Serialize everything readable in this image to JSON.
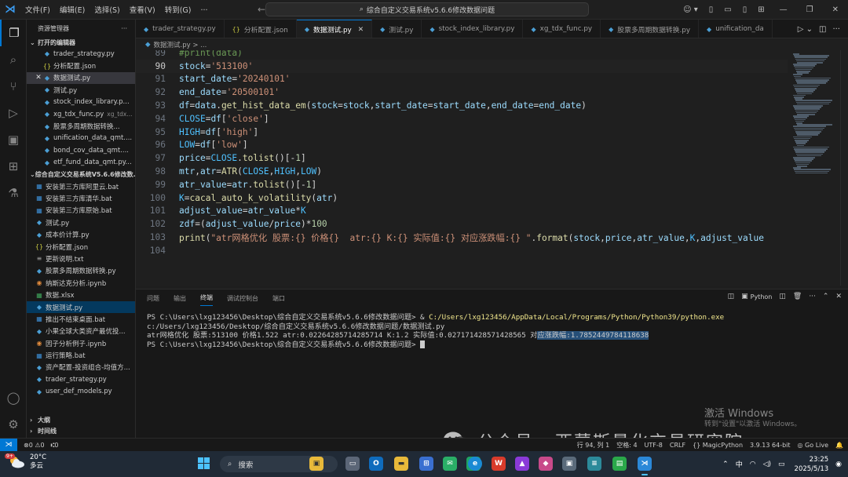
{
  "titlebar": {
    "menu": [
      "文件(F)",
      "编辑(E)",
      "选择(S)",
      "查看(V)",
      "转到(G)",
      "···"
    ],
    "search": "综合自定义交易系统v5.6.6修改数据问题"
  },
  "sidebar": {
    "header": "资源管理器",
    "open_editors_label": "打开的编辑器",
    "open_editors": [
      {
        "name": "trader_strategy.py",
        "type": "py"
      },
      {
        "name": "分析配置.json",
        "type": "json"
      },
      {
        "name": "数据测试.py",
        "type": "py",
        "close": "✕"
      },
      {
        "name": "测试.py",
        "type": "py"
      },
      {
        "name": "stock_index_library.p...",
        "type": "py"
      },
      {
        "name": "xg_tdx_func.py",
        "type": "py",
        "hint": "xg_tdx..."
      },
      {
        "name": "股票多周期数据转换...",
        "type": "py"
      },
      {
        "name": "unification_data_qmt....",
        "type": "py"
      },
      {
        "name": "bond_cov_data_qmt....",
        "type": "py"
      },
      {
        "name": "etf_fund_data_qmt.py...",
        "type": "py"
      }
    ],
    "folder_label": "综合自定义交易系统V5.6.6修改数...",
    "files": [
      {
        "name": "安装第三方库阿里云.bat",
        "type": "bat"
      },
      {
        "name": "安装第三方库清华.bat",
        "type": "bat"
      },
      {
        "name": "安装第三方库原始.bat",
        "type": "bat"
      },
      {
        "name": "测试.py",
        "type": "py"
      },
      {
        "name": "成本价计算.py",
        "type": "py"
      },
      {
        "name": "分析配置.json",
        "type": "json"
      },
      {
        "name": "更新说明.txt",
        "type": "txt"
      },
      {
        "name": "股票多周期数据转换.py",
        "type": "py"
      },
      {
        "name": "纳斯达克分析.ipynb",
        "type": "nb"
      },
      {
        "name": "数据.xlsx",
        "type": "xl"
      },
      {
        "name": "数据测试.py",
        "type": "py"
      },
      {
        "name": "推出不结束桌面.bat",
        "type": "bat"
      },
      {
        "name": "小果全球大类资产最优投...",
        "type": "py"
      },
      {
        "name": "因子分析例子.ipynb",
        "type": "nb"
      },
      {
        "name": "运行策略.bat",
        "type": "bat"
      },
      {
        "name": "资产配置-投资组合-均值方...",
        "type": "py"
      },
      {
        "name": "trader_strategy.py",
        "type": "py"
      },
      {
        "name": "user_def_models.py",
        "type": "py"
      }
    ],
    "outline_label": "大纲",
    "timeline_label": "时间线"
  },
  "tabs": [
    {
      "label": "trader_strategy.py",
      "type": "py"
    },
    {
      "label": "分析配置.json",
      "type": "json"
    },
    {
      "label": "数据测试.py",
      "type": "py",
      "active": true
    },
    {
      "label": "测试.py",
      "type": "py"
    },
    {
      "label": "stock_index_library.py",
      "type": "py"
    },
    {
      "label": "xg_tdx_func.py",
      "type": "py"
    },
    {
      "label": "股票多周期数据转换.py",
      "type": "py"
    },
    {
      "label": "unification_da",
      "type": "py"
    }
  ],
  "breadcrumb": "数据测试.py > ...",
  "editor": {
    "current_line": "90",
    "lines": [
      {
        "n": "89",
        "html": "<span class='c'>#print(data)</span>"
      },
      {
        "n": "90",
        "html": "<span class='v'>stock</span><span class='o'>=</span><span class='s'>'513100'</span>"
      },
      {
        "n": "91",
        "html": "<span class='v'>start_date</span><span class='o'>=</span><span class='s'>'20240101'</span>"
      },
      {
        "n": "92",
        "html": "<span class='v'>end_date</span><span class='o'>=</span><span class='s'>'20500101'</span>"
      },
      {
        "n": "93",
        "html": "<span class='v'>df</span><span class='o'>=</span><span class='v'>data</span><span class='o'>.</span><span class='f'>get_hist_data_em</span><span class='o'>(</span><span class='v'>stock</span><span class='o'>=</span><span class='v'>stock</span><span class='o'>,</span><span class='v'>start_date</span><span class='o'>=</span><span class='v'>start_date</span><span class='o'>,</span><span class='v'>end_date</span><span class='o'>=</span><span class='v'>end_date</span><span class='o'>)</span>"
      },
      {
        "n": "94",
        "html": "<span class='k'>CLOSE</span><span class='o'>=</span><span class='v'>df</span><span class='o'>[</span><span class='s'>'close'</span><span class='o'>]</span>"
      },
      {
        "n": "95",
        "html": "<span class='k'>HIGH</span><span class='o'>=</span><span class='v'>df</span><span class='o'>[</span><span class='s'>'high'</span><span class='o'>]</span>"
      },
      {
        "n": "96",
        "html": "<span class='k'>LOW</span><span class='o'>=</span><span class='v'>df</span><span class='o'>[</span><span class='s'>'low'</span><span class='o'>]</span>"
      },
      {
        "n": "97",
        "html": "<span class='v'>price</span><span class='o'>=</span><span class='k'>CLOSE</span><span class='o'>.</span><span class='f'>tolist</span><span class='o'>()[-</span><span class='n'>1</span><span class='o'>]</span>"
      },
      {
        "n": "98",
        "html": "<span class='v'>mtr</span><span class='o'>,</span><span class='v'>atr</span><span class='o'>=</span><span class='f'>ATR</span><span class='o'>(</span><span class='k'>CLOSE</span><span class='o'>,</span><span class='k'>HIGH</span><span class='o'>,</span><span class='k'>LOW</span><span class='o'>)</span>"
      },
      {
        "n": "99",
        "html": "<span class='v'>atr_value</span><span class='o'>=</span><span class='v'>atr</span><span class='o'>.</span><span class='f'>tolist</span><span class='o'>()[-</span><span class='n'>1</span><span class='o'>]</span>"
      },
      {
        "n": "100",
        "html": "<span class='k'>K</span><span class='o'>=</span><span class='f'>cacal_auto_k_volatility</span><span class='o'>(</span><span class='v'>atr</span><span class='o'>)</span>"
      },
      {
        "n": "101",
        "html": "<span class='v'>adjust_value</span><span class='o'>=</span><span class='v'>atr_value</span><span class='o'>*</span><span class='k'>K</span>"
      },
      {
        "n": "102",
        "html": "<span class='v'>zdf</span><span class='o'>=(</span><span class='v'>adjust_value</span><span class='o'>/</span><span class='v'>price</span><span class='o'>)*</span><span class='n'>100</span>"
      },
      {
        "n": "103",
        "html": "<span class='f'>print</span><span class='o'>(</span><span class='s'>\"atr网格优化 股票:{} 价格{}  atr:{} K:{} 实际值:{} 对应涨跌幅:{} \"</span><span class='o'>.</span><span class='f'>format</span><span class='o'>(</span><span class='v'>stock</span><span class='o'>,</span><span class='v'>price</span><span class='o'>,</span><span class='v'>atr_value</span><span class='o'>,</span><span class='k'>K</span><span class='o'>,</span><span class='v'>adjust_value</span>"
      },
      {
        "n": "104",
        "html": ""
      }
    ]
  },
  "panel": {
    "tabs": [
      "问题",
      "输出",
      "终端",
      "调试控制台",
      "端口"
    ],
    "active_tab": "终端",
    "shell": "Python",
    "terminal": {
      "cmd_prompt": "PS C:\\Users\\lxg123456\\Desktop\\综合自定义交易系统v5.6.6修改数据问题> & ",
      "cmd_exe": "C:/Users/lxg123456/AppData/Local/Programs/Python/Python39/python.exe",
      "cmd_arg": " c:/Users/lxg123456/Desktop/综合自定义交易系统v5.6.6修改数据问题/数据测试.py",
      "output_main": "atr网格优化 股票:513100 价格1.522  atr:0.02264285714285714 K:1.2 实际值:0.027171428571428565 对",
      "output_hl": "应涨跌幅:1.7852449784118638",
      "last_prompt": "PS C:\\Users\\lxg123456\\Desktop\\综合自定义交易系统v5.6.6修改数据问题> "
    }
  },
  "watermark": {
    "activate_title": "激活 Windows",
    "activate_sub": "转到\"设置\"以激活 Windows。",
    "wechat": "公众号 · 西蒙斯量化交易研究院"
  },
  "statusbar": {
    "errors": "⊗0 ⚠0",
    "ports": "⑆0",
    "line_col": "行 94, 列 1",
    "spaces": "空格: 4",
    "encoding": "UTF-8",
    "eol": "CRLF",
    "language": "{} MagicPython",
    "python": "3.9.13 64-bit",
    "right_extra": "◎ Go Live"
  },
  "taskbar": {
    "weather_temp": "20°C",
    "weather_desc": "多云",
    "weather_badge": "9+",
    "search": "搜索",
    "ime_lang": "中",
    "time": "23:25",
    "date": "2025/5/13"
  }
}
